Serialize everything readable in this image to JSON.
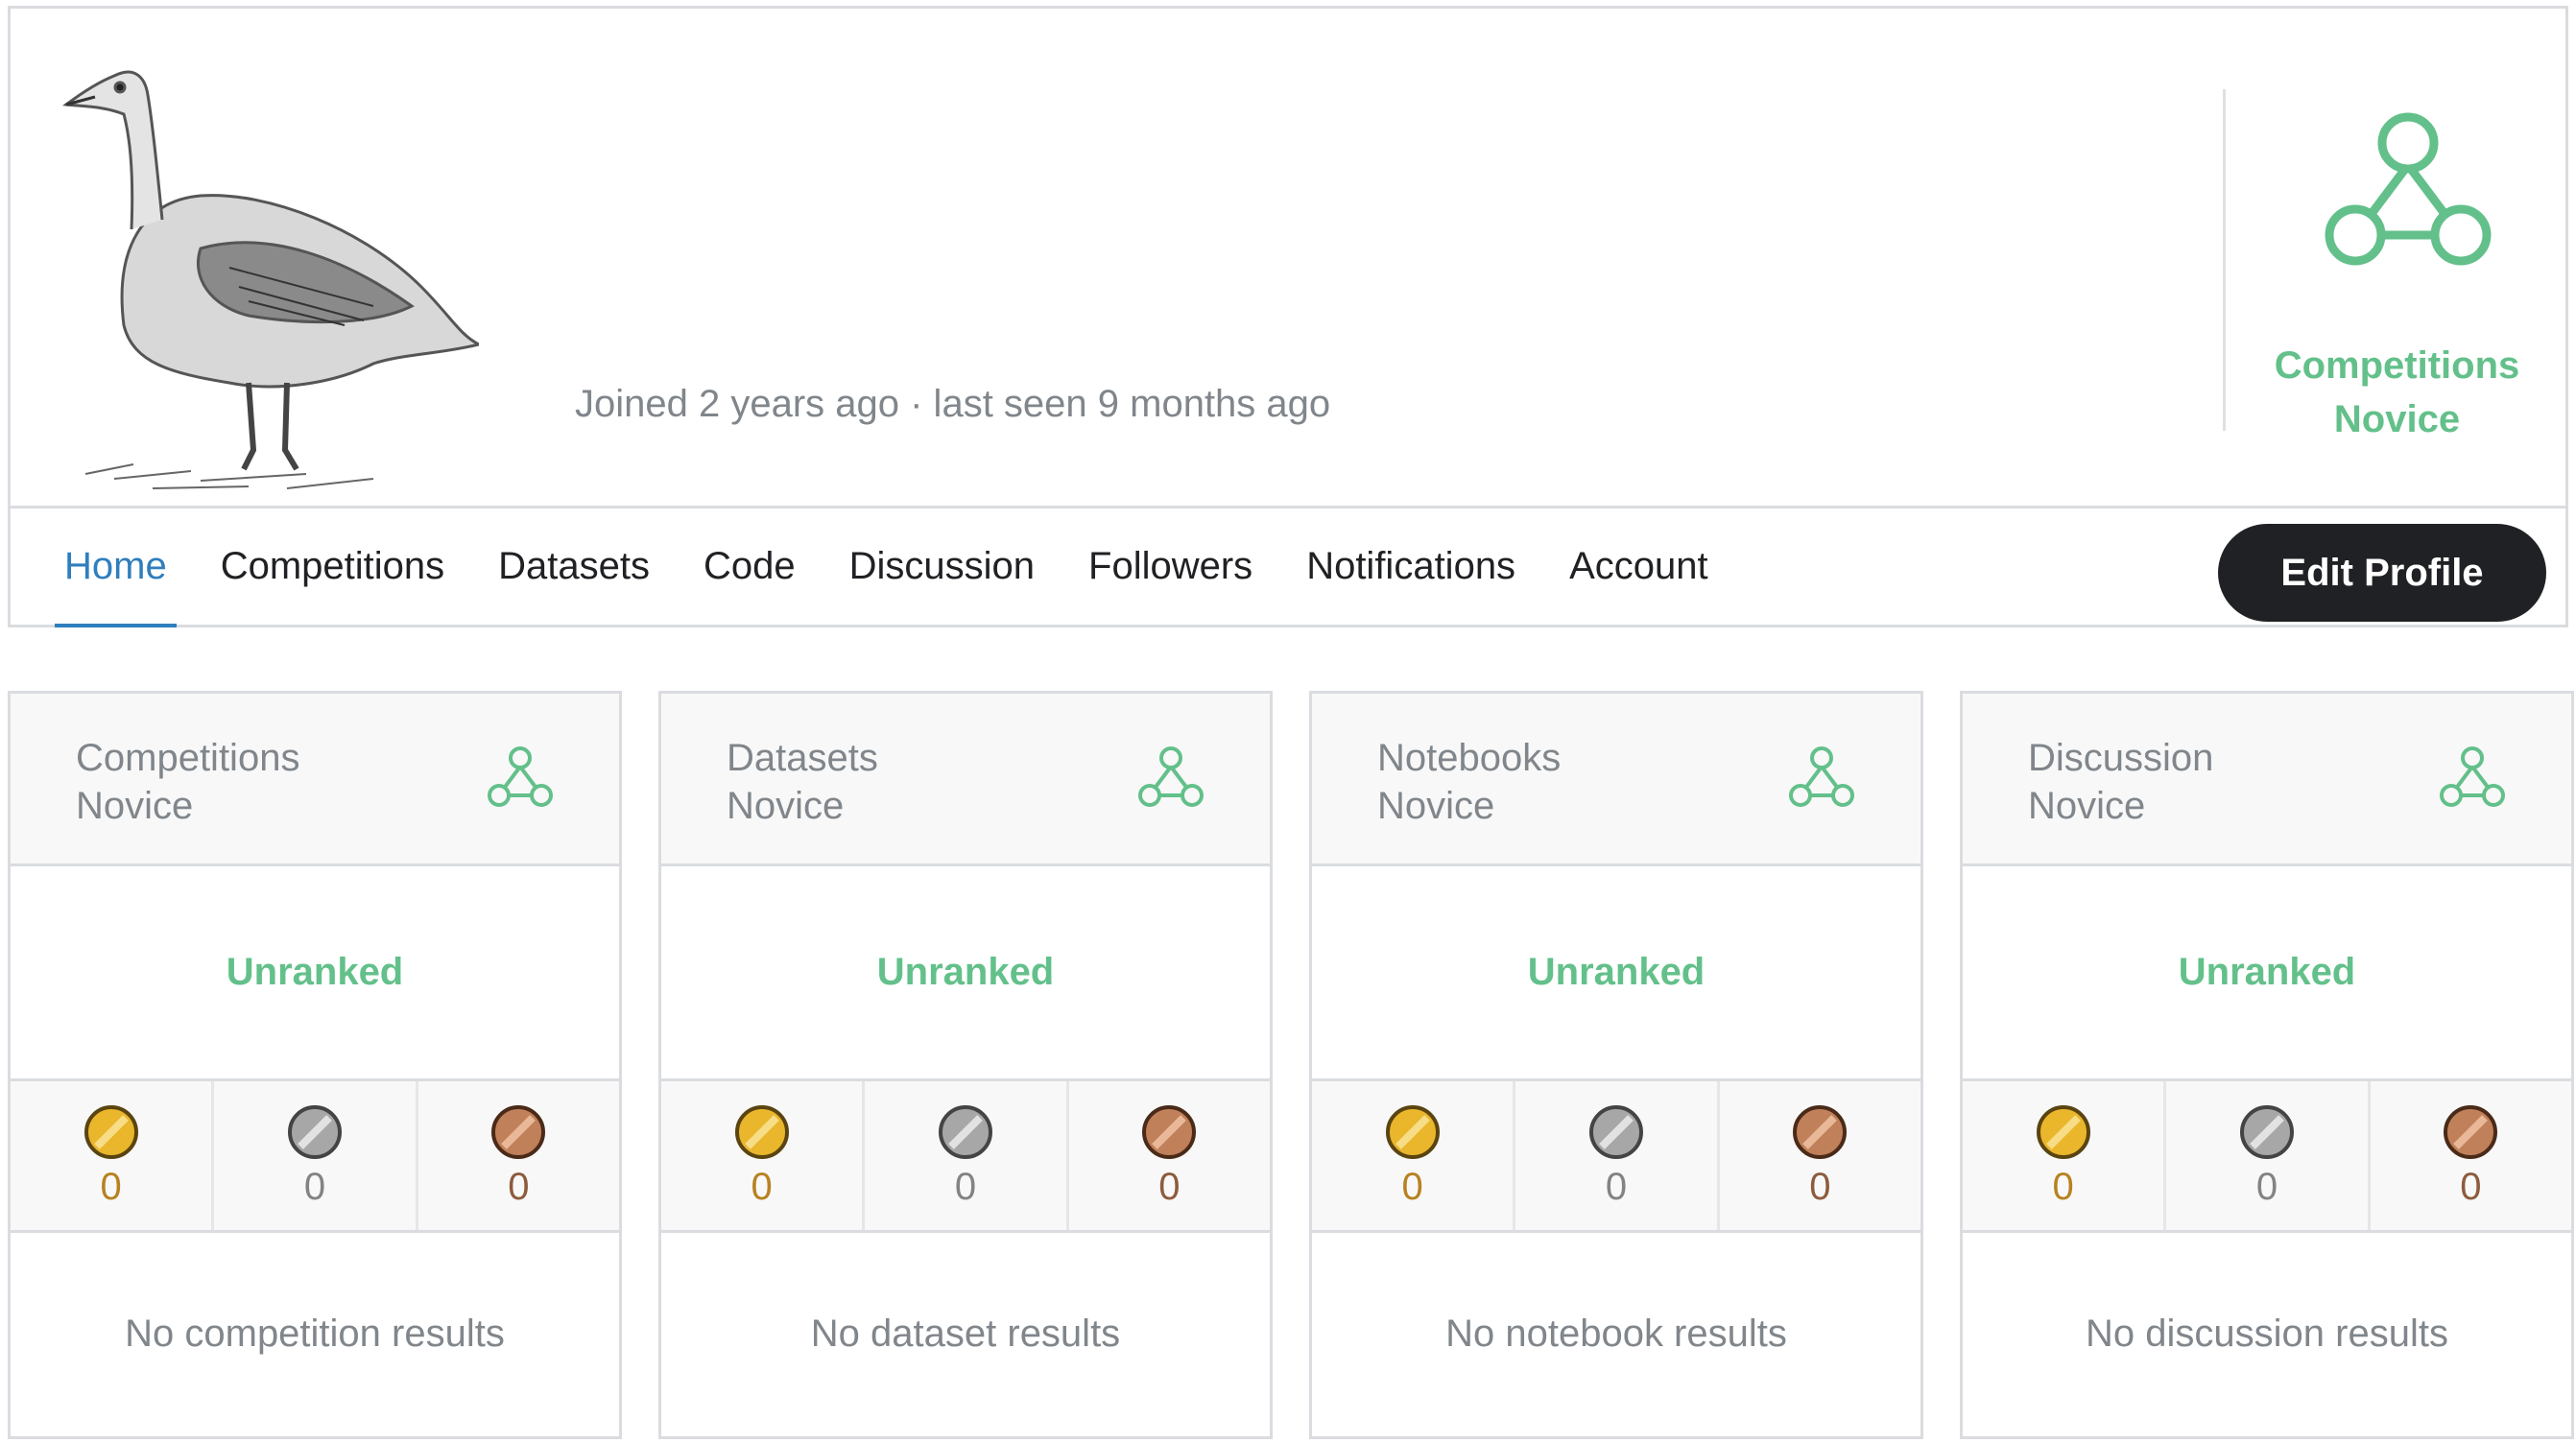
{
  "profile": {
    "joined_text": "Joined 2 years ago · last seen 9 months ago",
    "tier_label": "Competitions\nNovice",
    "tier_color": "#63c08a"
  },
  "nav": {
    "tabs": [
      "Home",
      "Competitions",
      "Datasets",
      "Code",
      "Discussion",
      "Followers",
      "Notifications",
      "Account"
    ],
    "active_tab": "Home",
    "edit_button": "Edit Profile"
  },
  "cards": [
    {
      "title": "Competitions\nNovice",
      "rank": "Unranked",
      "gold": "0",
      "silver": "0",
      "bronze": "0",
      "results": "No competition results"
    },
    {
      "title": "Datasets\nNovice",
      "rank": "Unranked",
      "gold": "0",
      "silver": "0",
      "bronze": "0",
      "results": "No dataset results"
    },
    {
      "title": "Notebooks\nNovice",
      "rank": "Unranked",
      "gold": "0",
      "silver": "0",
      "bronze": "0",
      "results": "No notebook results"
    },
    {
      "title": "Discussion\nNovice",
      "rank": "Unranked",
      "gold": "0",
      "silver": "0",
      "bronze": "0",
      "results": "No discussion results"
    }
  ],
  "colors": {
    "accent_blue": "#2f7ebd",
    "novice_green": "#63c08a",
    "gold": "#e9b62c",
    "silver": "#a7a7a7",
    "bronze": "#c0805a"
  },
  "icons": {
    "avatar": "goose-sketch-avatar",
    "tier": "novice-tier-icon",
    "medals": [
      "gold-medal-icon",
      "silver-medal-icon",
      "bronze-medal-icon"
    ]
  }
}
